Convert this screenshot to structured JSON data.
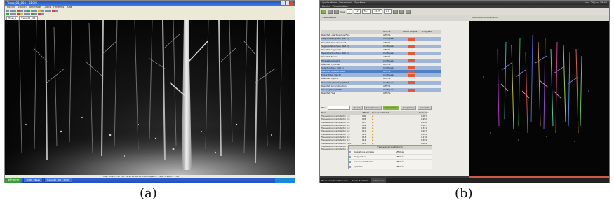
{
  "panel_a": {
    "title": "Trees_05_001 - 3D3M",
    "menu": [
      "Fichier",
      "Edition",
      "Affichage",
      "Outils",
      "Fenêtres",
      "Aide"
    ],
    "tabs": [
      "Trees_a",
      "Trees_05_001"
    ],
    "status": "Vue: 3D 26.1.07    Pos: -8.18 21.46 17.35    Occupancy: 39.87%    Zoom: 1.00",
    "taskbar": {
      "start": "démarrer",
      "tasks": [
        "3D3M - Trees",
        "Trees_05_001 - 3D3M"
      ]
    },
    "caption": "(a)"
  },
  "panel_b": {
    "topbar": [
      "Applications",
      "Raccourcis",
      "Système"
    ],
    "clock": "ven. 20 jan. 19:40",
    "menu": [
      "Fichier",
      "Visualisation"
    ],
    "toolbar": {
      "step_label": "Step",
      "val1": "1",
      "val2": "12",
      "val3": "56.2",
      "val4": "14.25",
      "val5": "2.0"
    },
    "subbar": {
      "left": "Transparence",
      "right": "Optimisation dimension"
    },
    "tree_header": {
      "name": "",
      "status": "Affiché",
      "state": "Statut étapes",
      "prog": "Progress."
    },
    "tree": [
      {
        "name": "Résultat LidarScanVue Fixe",
        "status": "Affiché",
        "cls": "",
        "btn": false
      },
      {
        "name": "PreprocessingStep (Ref 1)",
        "status": "Configuré",
        "cls": "hl",
        "btn": true
      },
      {
        "name": "Résultat Filtre Segment",
        "status": "Affiché",
        "cls": "",
        "btn": false
      },
      {
        "name": "SegmentationStep (Ref 2)",
        "status": "Configuré",
        "cls": "hl",
        "btn": true
      },
      {
        "name": "Résultat Segments",
        "status": "Affiché",
        "cls": "",
        "btn": false
      },
      {
        "name": "TreeDetectionStep (Ref 3)",
        "status": "Configuré",
        "cls": "hl",
        "btn": true
      },
      {
        "name": "Résultat Troncs",
        "status": "Affiché",
        "cls": "",
        "btn": false
      },
      {
        "name": "FittingStep (Ref 4)",
        "status": "Configuré",
        "cls": "hl",
        "btn": true
      },
      {
        "name": "Résultat Cylindres",
        "status": "Affiché",
        "cls": "",
        "btn": false
      },
      {
        "name": "SelectionStep (Ref 5)",
        "status": "Configuré",
        "cls": "hl",
        "btn": true
      },
      {
        "name": "Résultat Arbres Filtrés",
        "status": "Affiché",
        "cls": "sel",
        "btn": true
      },
      {
        "name": "ExportStep (Ref 6)",
        "status": "Configuré",
        "cls": "hl",
        "btn": true
      },
      {
        "name": "Résultat Export",
        "status": "Affiché",
        "cls": "",
        "btn": false
      },
      {
        "name": "ReconstructionStep (Ref 7)",
        "status": "Configuré",
        "cls": "hl",
        "btn": true
      },
      {
        "name": "Résultat Reconstruction",
        "status": "Affiché",
        "cls": "",
        "btn": false
      },
      {
        "name": "MergingStep (Ref 8)",
        "status": "Configuré",
        "cls": "hl",
        "btn": true
      },
      {
        "name": "Résultat Final",
        "status": "Affiché",
        "cls": "",
        "btn": false
      }
    ],
    "filter": {
      "label": "Filtre",
      "buttons": [
        "Aucun",
        "Sélectionner",
        "Colorisation",
        "Supprimer",
        "Convertir"
      ]
    },
    "table_header": [
      "Nom",
      "Affiché",
      "Sélection.",
      "Statut",
      "Diamètre"
    ],
    "table": [
      [
        "TreeGeometricalDetector 1.0",
        "100",
        "●",
        "",
        "1.087"
      ],
      [
        "TreeGeometricalDetector 2.0",
        "103",
        "●",
        "",
        "0.952"
      ],
      [
        "TreeGeometricalDetector 3.0",
        "107",
        "●",
        "",
        "1.856"
      ],
      [
        "TreeGeometricalDetector 4.0",
        "109",
        "●",
        "",
        "1.827"
      ],
      [
        "TreeGeometricalDetector 5.0",
        "110",
        "●",
        "",
        "1.311"
      ],
      [
        "TreeGeometricalDetector 6.0",
        "111",
        "●",
        "",
        "0.927"
      ],
      [
        "TreeGeometricalDetector 7.0",
        "112",
        "●",
        "",
        "1.039"
      ],
      [
        "TreeGeometricalDetector 8.0",
        "113",
        "●",
        "",
        "2.179"
      ],
      [
        "TreeGeometricalDetector 9.0",
        "114",
        "●",
        "",
        "1.554"
      ],
      [
        "TreeGeometricalDetector 10.0",
        "115",
        "●",
        "",
        "1.469"
      ],
      [
        "TreeGeometricalDetector 11.0",
        "116",
        "●",
        "",
        "2.214"
      ],
      [
        "TreeGeometricalDetector 12.0",
        "117",
        "●",
        "",
        "1.317"
      ]
    ],
    "props": {
      "caption": "TreeGeometricalDetector",
      "rows": [
        {
          "k": "Opérations simples",
          "v": "affichée"
        },
        {
          "k": "Diagnostics",
          "v": "affichée"
        },
        {
          "k": "Groupes de Points",
          "v": "affichée"
        },
        {
          "k": "Cylindres",
          "v": "affichée"
        }
      ]
    },
    "status": [
      "TreeGeometricalDetector 1 · Points 312 312",
      "Computree"
    ],
    "caption": "(b)"
  }
}
